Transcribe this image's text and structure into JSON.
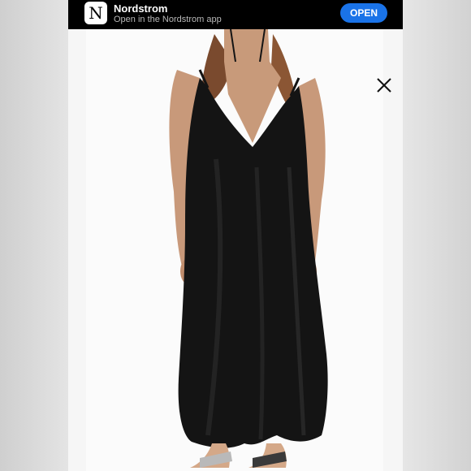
{
  "banner": {
    "app_name": "Nordstrom",
    "subtitle": "Open in the Nordstrom app",
    "icon_letter": "N",
    "open_label": "OPEN",
    "button_color": "#1a73e8"
  },
  "photo": {
    "subject": "black-maxi-dress",
    "dress_color": "#141414"
  },
  "icons": {
    "close": "close-icon"
  }
}
